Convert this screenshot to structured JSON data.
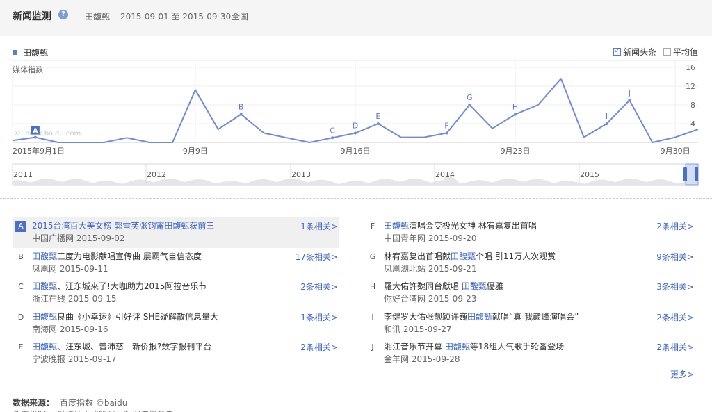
{
  "header": {
    "title": "新闻监测",
    "keyword": "田馥甄",
    "date_range": "2015-09-01 至 2015-09-30",
    "region": "全国"
  },
  "legend": {
    "series_name": "田馥甄"
  },
  "options": [
    {
      "label": "新闻头条",
      "checked": true
    },
    {
      "label": "平均值",
      "checked": false
    }
  ],
  "watermark": "© index.baidu.com",
  "chart_data": {
    "type": "line",
    "ylabel": "媒体指数",
    "ylim": [
      0,
      16
    ],
    "yticks": [
      4,
      8,
      12,
      16
    ],
    "x_tick_labels": [
      {
        "day": 1,
        "label": "2015年9月1日"
      },
      {
        "day": 9,
        "label": "9月9日"
      },
      {
        "day": 16,
        "label": "9月16日"
      },
      {
        "day": 23,
        "label": "9月23日"
      },
      {
        "day": 30,
        "label": "9月30日"
      }
    ],
    "x": [
      1,
      2,
      3,
      4,
      5,
      6,
      7,
      8,
      9,
      10,
      11,
      12,
      13,
      14,
      15,
      16,
      17,
      18,
      19,
      20,
      21,
      22,
      23,
      24,
      25,
      26,
      27,
      28,
      29,
      30,
      31
    ],
    "series": [
      {
        "name": "田馥甄",
        "values": [
          0.4,
          1.1,
          0,
          0,
          0,
          1,
          0,
          0,
          11.2,
          2.8,
          6,
          2,
          1,
          0,
          1,
          2,
          4,
          1.1,
          1.1,
          2,
          8,
          3,
          6,
          8,
          13.6,
          1.1,
          4,
          9,
          0,
          1.1,
          2.8
        ]
      }
    ],
    "annotations": [
      {
        "label": "A",
        "day": 2
      },
      {
        "label": "B",
        "day": 11
      },
      {
        "label": "C",
        "day": 15
      },
      {
        "label": "D",
        "day": 16
      },
      {
        "label": "E",
        "day": 17
      },
      {
        "label": "F",
        "day": 20
      },
      {
        "label": "G",
        "day": 21
      },
      {
        "label": "H",
        "day": 23
      },
      {
        "label": "I",
        "day": 27
      },
      {
        "label": "J",
        "day": 28
      }
    ],
    "overview_years": [
      "2011",
      "2012",
      "2013",
      "2014",
      "2015"
    ]
  },
  "news_left": [
    {
      "marker": "A",
      "pre": "",
      "hl": "",
      "post": "2015台湾百大美女榜 郭雪芙张钧甯田馥甄获前三",
      "source": "中国广播网 2015-09-02",
      "related": "1条相关>",
      "active": true
    },
    {
      "marker": "B",
      "pre": "",
      "hl": "田馥甄",
      "post": "三度为电影献唱宣传曲 展霸气自信态度",
      "source": "凤凰网 2015-09-11",
      "related": "17条相关>",
      "active": false
    },
    {
      "marker": "C",
      "pre": "",
      "hl": "田馥甄",
      "post": "、汪东城来了!大咖助力2015阿拉音乐节",
      "source": "浙江在线 2015-09-15",
      "related": "2条相关>",
      "active": false
    },
    {
      "marker": "D",
      "pre": "",
      "hl": "田馥甄",
      "post": "良曲《小幸运》引好评 SHE疑解散信息量大",
      "source": "南海网 2015-09-16",
      "related": "1条相关>",
      "active": false
    },
    {
      "marker": "E",
      "pre": "",
      "hl": "田馥甄",
      "post": "、汪东城、曾沛慈 - 新侨报?数字报刊平台",
      "source": "宁波晚报 2015-09-17",
      "related": "2条相关>",
      "active": false
    }
  ],
  "news_right": [
    {
      "marker": "F",
      "pre": "",
      "hl": "田馥甄",
      "post": "演唱会变极光女神 林宥嘉复出首唱",
      "source": "中国青年网 2015-09-20",
      "related": "2条相关>",
      "active": false
    },
    {
      "marker": "G",
      "pre": "林宥嘉复出首唱献",
      "hl": "田馥甄",
      "post": "个唱 引11万人次观赏",
      "source": "凤凰湖北站 2015-09-21",
      "related": "9条相关>",
      "active": false
    },
    {
      "marker": "H",
      "pre": "羅大佑許魏同台獻唱 ",
      "hl": "田馥甄",
      "post": "優雅",
      "source": "你好台湾网 2015-09-23",
      "related": "3条相关>",
      "active": false
    },
    {
      "marker": "I",
      "pre": "李健罗大佑张靓颖许巍",
      "hl": "田馥甄",
      "post": "献唱“真 我巅峰演唱会”",
      "source": "和讯 2015-09-27",
      "related": "2条相关>",
      "active": false
    },
    {
      "marker": "J",
      "pre": "湘江音乐节开幕 ",
      "hl": "田馥甄",
      "post": "等18组人气歌手轮番登场",
      "source": "金羊网 2015-09-28",
      "related": "2条相关>",
      "active": false
    }
  ],
  "more_link": "更多>",
  "footer": {
    "source_label": "数据来源：",
    "source_value": "百度指数 ©baidu",
    "note": "免责说明： 受统计方式所限，数据仅供参考"
  },
  "colors": {
    "line": "#6f8bd9",
    "accent": "#3e66c9",
    "marker_active": "#4a6fc9"
  }
}
